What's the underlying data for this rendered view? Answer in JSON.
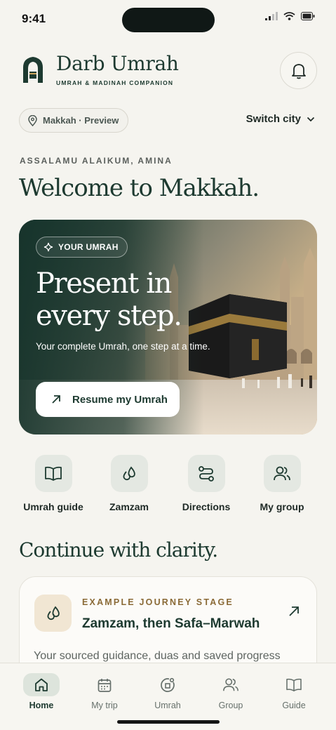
{
  "status_bar": {
    "time": "9:41"
  },
  "header": {
    "brand_title": "Darb Umrah",
    "brand_subtitle": "UMRAH & MADINAH COMPANION",
    "location": "Makkah · Preview",
    "switch_city": "Switch city"
  },
  "greeting": "ASSALAMU ALAIKUM, AMINA",
  "welcome": "Welcome to Makkah.",
  "hero": {
    "chip": "YOUR UMRAH",
    "title": "Present in every step.",
    "subtitle": "Your complete Umrah, one step at a time.",
    "cta": "Resume my Umrah"
  },
  "quick_actions": [
    {
      "label": "Umrah guide",
      "icon": "book-icon"
    },
    {
      "label": "Zamzam",
      "icon": "water-drops-icon"
    },
    {
      "label": "Directions",
      "icon": "route-icon"
    },
    {
      "label": "My group",
      "icon": "group-icon"
    }
  ],
  "section_title": "Continue with clarity.",
  "journey_card": {
    "overline": "EXAMPLE JOURNEY STAGE",
    "title": "Zamzam, then Safa–Marwah",
    "description": "Your sourced guidance, duas and saved progress"
  },
  "tabs": [
    {
      "label": "Home",
      "icon": "home-icon",
      "active": true
    },
    {
      "label": "My trip",
      "icon": "calendar-icon",
      "active": false
    },
    {
      "label": "Umrah",
      "icon": "circle-path-icon",
      "active": false
    },
    {
      "label": "Group",
      "icon": "group-icon",
      "active": false
    },
    {
      "label": "Guide",
      "icon": "book-icon",
      "active": false
    }
  ],
  "colors": {
    "brand": "#1d3a30",
    "accent_gold": "#8a6a36",
    "background": "#f5f4ef"
  }
}
